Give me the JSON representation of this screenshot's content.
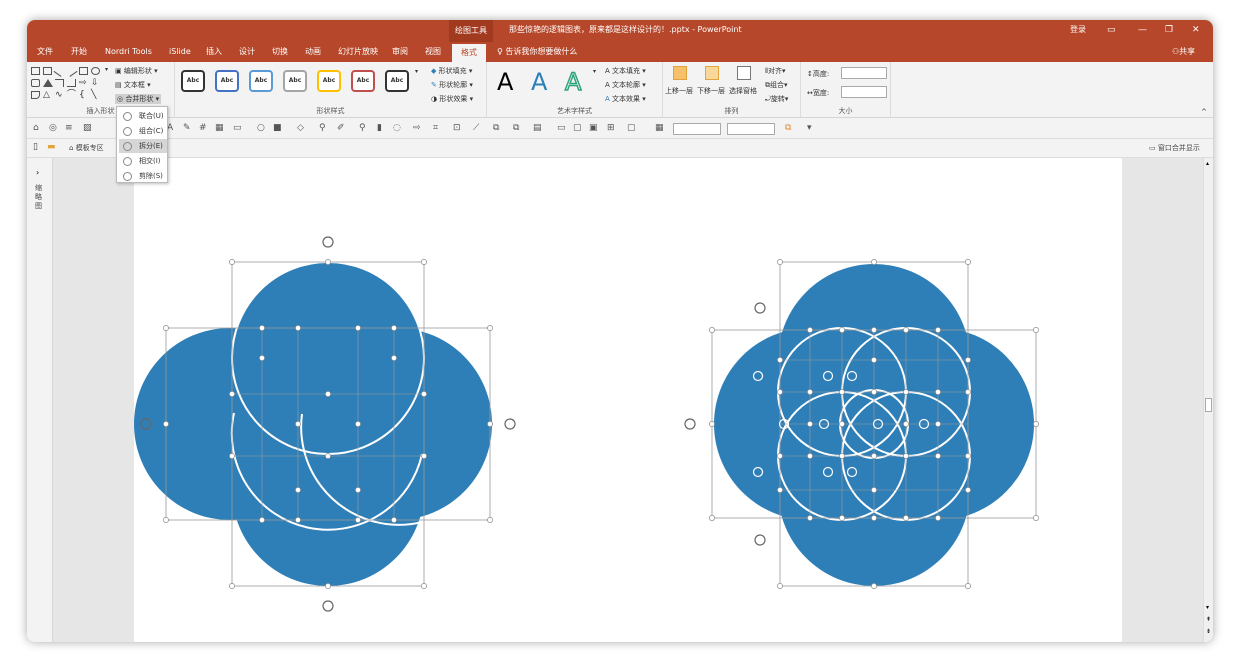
{
  "window": {
    "context_tab": "绘图工具",
    "doc_title": "那些惊艳的逻辑图表，原来都是这样设计的！.pptx - PowerPoint",
    "login": "登录",
    "minimize": "—",
    "restore": "❐",
    "close": "✕"
  },
  "tabs": [
    "文件",
    "开始",
    "Nordri Tools",
    "iSlide",
    "插入",
    "设计",
    "切换",
    "动画",
    "幻灯片放映",
    "审阅",
    "视图",
    "格式"
  ],
  "tell_me": "告诉我你想要做什么",
  "share": "共享",
  "ribbon": {
    "insert_shapes": {
      "label": "插入形状",
      "edit_shape": "编辑形状",
      "text_box": "文本框",
      "merge_shapes": "合并形状"
    },
    "shape_styles": {
      "label": "形状样式",
      "swatch_text": "Abc",
      "fill": "形状填充",
      "outline": "形状轮廓",
      "effects": "形状效果"
    },
    "wordart": {
      "label": "艺术字样式",
      "letter": "A",
      "text_fill": "文本填充",
      "text_outline": "文本轮廓",
      "text_effects": "文本效果"
    },
    "arrange": {
      "label": "排列",
      "bring_forward": "上移一层",
      "send_backward": "下移一层",
      "selection_pane": "选择窗格",
      "align": "对齐",
      "group": "组合",
      "rotate": "旋转"
    },
    "size": {
      "label": "大小",
      "height": "高度:",
      "width": "宽度:"
    }
  },
  "toolbar2": {
    "template_zone": "模板专区",
    "merge_window": "窗口合并显示"
  },
  "left_pane": {
    "label": "缩略图"
  },
  "merge_menu": [
    {
      "label": "联合(U)",
      "active": false
    },
    {
      "label": "组合(C)",
      "active": false
    },
    {
      "label": "拆分(E)",
      "active": true
    },
    {
      "label": "相交(I)",
      "active": false
    },
    {
      "label": "剪除(S)",
      "active": false
    }
  ],
  "colors": {
    "accent": "#b7472a",
    "circle_fill": "#2e7fb8",
    "circle_stroke": "#ffffff"
  }
}
